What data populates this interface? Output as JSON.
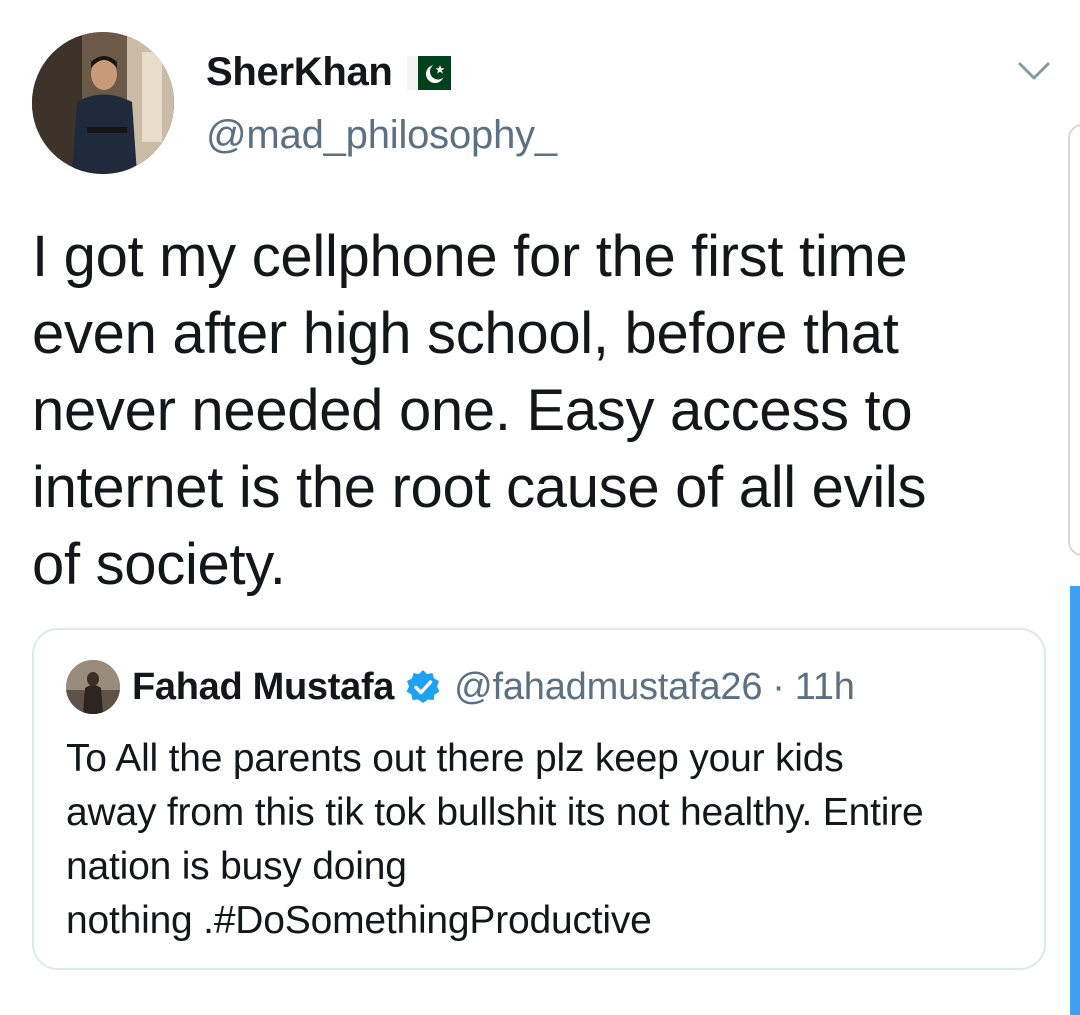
{
  "tweet": {
    "author": {
      "display_name": "SherKhan",
      "handle": "@mad_philosophy_",
      "flag_icon": "pakistan-flag-icon",
      "avatar": "user-avatar"
    },
    "menu_icon": "chevron-down-icon",
    "text_lines": [
      "I got my cellphone for the first time",
      "even after high school, before that",
      "never needed one. Easy access to",
      "internet is the root cause of all evils",
      "of society."
    ],
    "quoted": {
      "display_name": "Fahad Mustafa",
      "verified_icon": "verified-badge-icon",
      "handle": "@fahadmustafa26",
      "separator": "·",
      "time": "11h",
      "text_lines": [
        "To All the parents out there plz keep your kids",
        "away from this tik tok bullshit its not healthy. Entire",
        "nation is busy doing",
        "nothing .#DoSomethingProductive"
      ]
    }
  },
  "colors": {
    "text_primary": "#14171a",
    "text_secondary": "#5b7083",
    "verified_blue": "#1da1f2",
    "card_border": "#e1e8ed",
    "flag_green": "#01411c",
    "edge_bar_blue": "#3ea1f2"
  }
}
